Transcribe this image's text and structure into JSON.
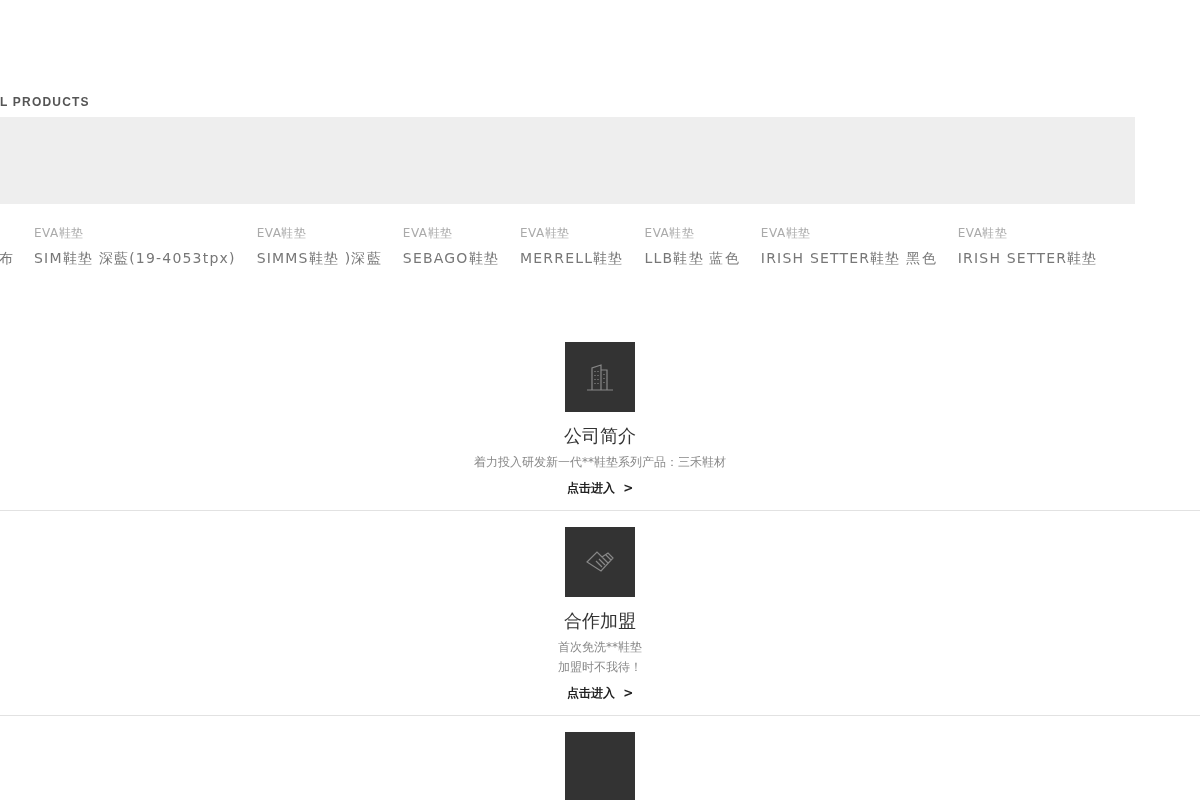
{
  "products_heading": "L PRODUCTS",
  "products": [
    {
      "name": "布"
    },
    {
      "category": "EVA鞋垫",
      "name": "SIM鞋垫 深藍(19-4053tpx)"
    },
    {
      "category": "EVA鞋垫",
      "name": "SIMMS鞋垫 )深藍"
    },
    {
      "category": "EVA鞋垫",
      "name": "SEBAGO鞋垫"
    },
    {
      "category": "EVA鞋垫",
      "name": "MERRELL鞋垫"
    },
    {
      "category": "EVA鞋垫",
      "name": "LLB鞋垫 蓝色"
    },
    {
      "category": "EVA鞋垫",
      "name": "IRISH SETTER鞋垫 黑色"
    },
    {
      "category": "EVA鞋垫",
      "name": "IRISH SETTER鞋垫"
    }
  ],
  "sections": [
    {
      "kind": "building",
      "title": "公司简介",
      "lines": [
        "着力投入研发新一代**鞋垫系列产品：三禾鞋材"
      ],
      "link": "点击进入",
      "arrow": ">"
    },
    {
      "kind": "handshake",
      "title": "合作加盟",
      "lines": [
        "首次免洗**鞋垫",
        "加盟时不我待！"
      ],
      "link": "点击进入",
      "arrow": ">"
    },
    {
      "kind": "plain"
    }
  ]
}
